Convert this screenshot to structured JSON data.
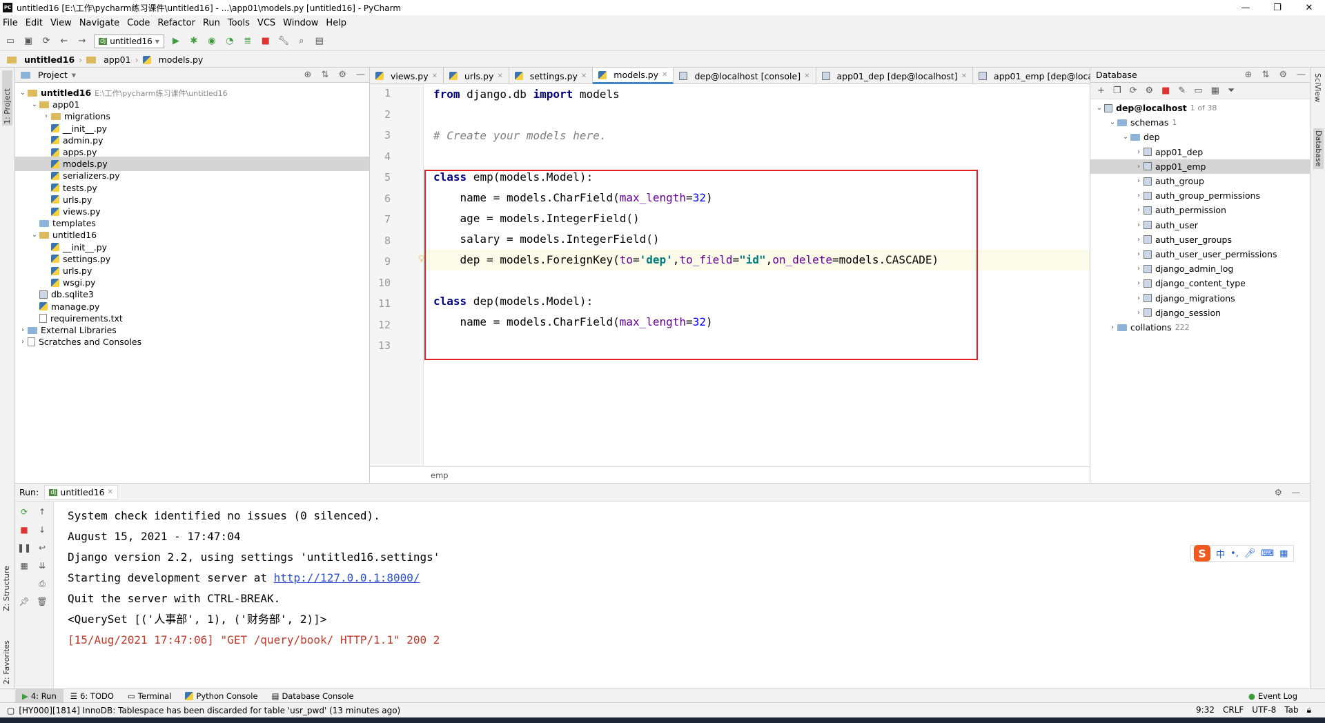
{
  "window": {
    "title": "untitled16 [E:\\工作\\pycharm练习课件\\untitled16] - ...\\app01\\models.py [untitled16] - PyCharm",
    "logo": "PC"
  },
  "menu": [
    "File",
    "Edit",
    "View",
    "Navigate",
    "Code",
    "Refactor",
    "Run",
    "Tools",
    "VCS",
    "Window",
    "Help"
  ],
  "run_config": "untitled16",
  "breadcrumb": [
    "untitled16",
    "app01",
    "models.py"
  ],
  "left_tabs": {
    "project": "1: Project",
    "structure": "Z: Structure",
    "favorites": "2: Favorites"
  },
  "right_tabs": {
    "sciview": "SciView",
    "database": "Database"
  },
  "project": {
    "header": "Project",
    "items": [
      {
        "label": "untitled16",
        "note": "E:\\工作\\pycharm练习课件\\untitled16",
        "depth": 0,
        "icon": "folder",
        "open": true,
        "bold": true
      },
      {
        "label": "app01",
        "depth": 1,
        "icon": "folder",
        "open": true
      },
      {
        "label": "migrations",
        "depth": 2,
        "icon": "folder",
        "closed": true
      },
      {
        "label": "__init__.py",
        "depth": 2,
        "icon": "py"
      },
      {
        "label": "admin.py",
        "depth": 2,
        "icon": "py"
      },
      {
        "label": "apps.py",
        "depth": 2,
        "icon": "py"
      },
      {
        "label": "models.py",
        "depth": 2,
        "icon": "py",
        "selected": true
      },
      {
        "label": "serializers.py",
        "depth": 2,
        "icon": "py"
      },
      {
        "label": "tests.py",
        "depth": 2,
        "icon": "py"
      },
      {
        "label": "urls.py",
        "depth": 2,
        "icon": "py"
      },
      {
        "label": "views.py",
        "depth": 2,
        "icon": "py"
      },
      {
        "label": "templates",
        "depth": 1,
        "icon": "folder-blue"
      },
      {
        "label": "untitled16",
        "depth": 1,
        "icon": "folder",
        "open": true
      },
      {
        "label": "__init__.py",
        "depth": 2,
        "icon": "py"
      },
      {
        "label": "settings.py",
        "depth": 2,
        "icon": "py"
      },
      {
        "label": "urls.py",
        "depth": 2,
        "icon": "py"
      },
      {
        "label": "wsgi.py",
        "depth": 2,
        "icon": "py"
      },
      {
        "label": "db.sqlite3",
        "depth": 1,
        "icon": "db"
      },
      {
        "label": "manage.py",
        "depth": 1,
        "icon": "py"
      },
      {
        "label": "requirements.txt",
        "depth": 1,
        "icon": "txt"
      },
      {
        "label": "External Libraries",
        "depth": 0,
        "icon": "lib",
        "closed": true
      },
      {
        "label": "Scratches and Consoles",
        "depth": 0,
        "icon": "scratch",
        "closed": true
      }
    ]
  },
  "editor": {
    "tabs": [
      {
        "label": "views.py",
        "active": false
      },
      {
        "label": "urls.py",
        "active": false
      },
      {
        "label": "settings.py",
        "active": false
      },
      {
        "label": "models.py",
        "active": true
      },
      {
        "label": "dep@localhost [console]",
        "active": false
      },
      {
        "label": "app01_dep [dep@localhost]",
        "active": false
      },
      {
        "label": "app01_emp [dep@localhost]",
        "active": false
      }
    ],
    "line_numbers": [
      "1",
      "2",
      "3",
      "4",
      "5",
      "6",
      "7",
      "8",
      "9",
      "10",
      "11",
      "12",
      "13"
    ],
    "breadcrumb": "emp"
  },
  "database": {
    "header": "Database",
    "items": [
      {
        "label": "dep@localhost",
        "note": "1 of 38",
        "depth": 0,
        "open": true,
        "bold": true
      },
      {
        "label": "schemas",
        "note": "1",
        "depth": 1,
        "open": true
      },
      {
        "label": "dep",
        "depth": 2,
        "open": true
      },
      {
        "label": "app01_dep",
        "depth": 3
      },
      {
        "label": "app01_emp",
        "depth": 3,
        "selected": true
      },
      {
        "label": "auth_group",
        "depth": 3
      },
      {
        "label": "auth_group_permissions",
        "depth": 3
      },
      {
        "label": "auth_permission",
        "depth": 3
      },
      {
        "label": "auth_user",
        "depth": 3
      },
      {
        "label": "auth_user_groups",
        "depth": 3
      },
      {
        "label": "auth_user_user_permissions",
        "depth": 3
      },
      {
        "label": "django_admin_log",
        "depth": 3
      },
      {
        "label": "django_content_type",
        "depth": 3
      },
      {
        "label": "django_migrations",
        "depth": 3
      },
      {
        "label": "django_session",
        "depth": 3
      },
      {
        "label": "collations",
        "note": "222",
        "depth": 1,
        "folder": true
      }
    ]
  },
  "run": {
    "label": "Run:",
    "tab": "untitled16",
    "output": [
      {
        "text": "System check identified no issues (0 silenced).",
        "cls": ""
      },
      {
        "text": "August 15, 2021 - 17:47:04",
        "cls": ""
      },
      {
        "text": "Django version 2.2, using settings 'untitled16.settings'",
        "cls": ""
      },
      {
        "text": "Starting development server at ",
        "link": "http://127.0.0.1:8000/",
        "cls": ""
      },
      {
        "text": "Quit the server with CTRL-BREAK.",
        "cls": ""
      },
      {
        "text": "<QuerySet [('人事部', 1), ('财务部', 2)]>",
        "cls": ""
      },
      {
        "text": "[15/Aug/2021 17:47:06] \"GET /query/book/ HTTP/1.1\" 200 2",
        "cls": "red"
      }
    ]
  },
  "ime": {
    "logo": "S",
    "lang": "中",
    "punct": "•,"
  },
  "bottom_tabs": [
    "4: Run",
    "6: TODO",
    "Terminal",
    "Python Console",
    "Database Console"
  ],
  "event_log": "Event Log",
  "status": {
    "message": "[HY000][1814] InnoDB: Tablespace has been discarded for table 'usr_pwd' (13 minutes ago)",
    "position": "9:32",
    "line_sep": "CRLF",
    "encoding": "UTF-8",
    "indent": "Tab"
  }
}
